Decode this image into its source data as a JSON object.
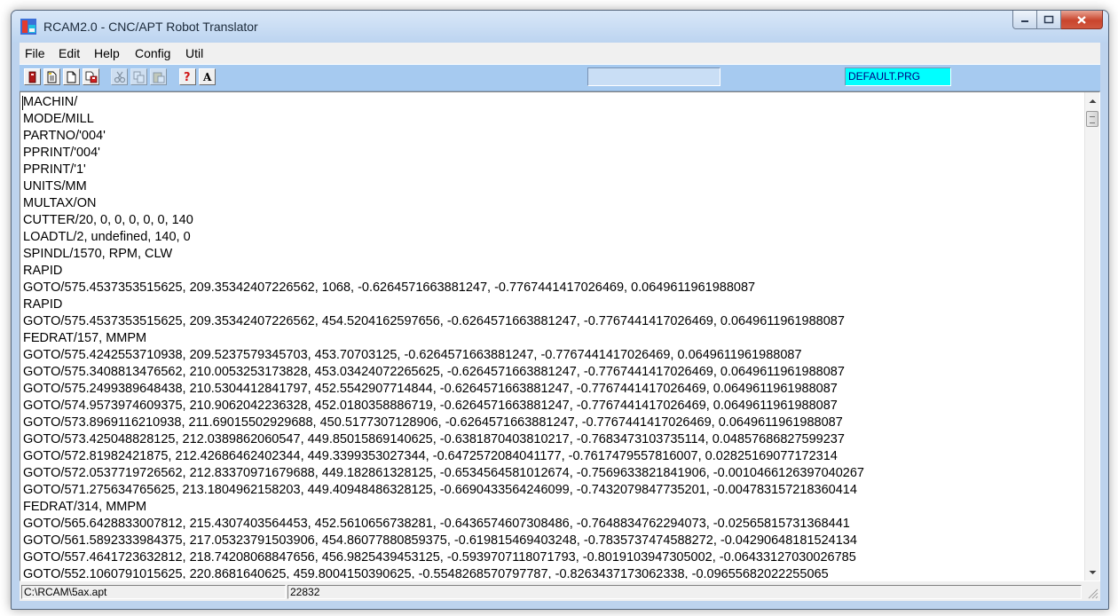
{
  "window": {
    "title": "RCAM2.0 - CNC/APT Robot Translator"
  },
  "menu": [
    "File",
    "Edit",
    "Help",
    "Config",
    "Util"
  ],
  "toolbar": {
    "program_field": "DEFAULT.PRG",
    "buttons": [
      "exit-icon",
      "open-file-icon",
      "new-file-icon",
      "save-file-icon",
      "cut-icon",
      "copy-icon",
      "paste-icon",
      "help-icon",
      "font-icon"
    ]
  },
  "editor": {
    "lines": [
      "MACHIN/",
      "MODE/MILL",
      "PARTNO/'004'",
      "PPRINT/'004'",
      "PPRINT/'1'",
      "UNITS/MM",
      "MULTAX/ON",
      "CUTTER/20, 0, 0, 0, 0, 0, 140",
      "LOADTL/2, undefined, 140, 0",
      "SPINDL/1570, RPM, CLW",
      "RAPID",
      "GOTO/575.4537353515625, 209.35342407226562, 1068, -0.6264571663881247, -0.7767441417026469, 0.0649611961988087",
      "RAPID",
      "GOTO/575.4537353515625, 209.35342407226562, 454.5204162597656, -0.6264571663881247, -0.7767441417026469, 0.0649611961988087",
      "FEDRAT/157, MMPM",
      "GOTO/575.4242553710938, 209.5237579345703, 453.70703125, -0.6264571663881247, -0.7767441417026469, 0.0649611961988087",
      "GOTO/575.3408813476562, 210.0053253173828, 453.03424072265625, -0.6264571663881247, -0.7767441417026469, 0.0649611961988087",
      "GOTO/575.2499389648438, 210.5304412841797, 452.5542907714844, -0.6264571663881247, -0.7767441417026469, 0.0649611961988087",
      "GOTO/574.9573974609375, 210.9062042236328, 452.0180358886719, -0.6264571663881247, -0.7767441417026469, 0.0649611961988087",
      "GOTO/573.8969116210938, 211.69015502929688, 450.5177307128906, -0.6264571663881247, -0.7767441417026469, 0.0649611961988087",
      "GOTO/573.425048828125, 212.0389862060547, 449.85015869140625, -0.6381870403810217, -0.7683473103735114, 0.04857686827599237",
      "GOTO/572.81982421875, 212.42686462402344, 449.3399353027344, -0.6472572084041177, -0.7617479557816007, 0.02825169077172314",
      "GOTO/572.0537719726562, 212.83370971679688, 449.182861328125, -0.6534564581012674, -0.7569633821841906, -0.0010466126397040267",
      "GOTO/571.275634765625, 213.1804962158203, 449.40948486328125, -0.6690433564246099, -0.7432079847735201, -0.004783157218360414",
      "FEDRAT/314, MMPM",
      "GOTO/565.6428833007812, 215.4307403564453, 452.5610656738281, -0.6436574607308486, -0.7648834762294073, -0.02565815731368441",
      "GOTO/561.5892333984375, 217.05323791503906, 454.86077880859375, -0.619815469403248, -0.7835737474588272, -0.04290648181524134",
      "GOTO/557.4641723632812, 218.74208068847656, 456.9825439453125, -0.5939707118071793, -0.8019103947305002, -0.06433127030026785",
      "GOTO/552.1060791015625, 220.8681640625, 459.8004150390625, -0.5548268570797787, -0.8263437173062338, -0.09655682022255065"
    ]
  },
  "status": {
    "file_path": "C:\\RCAM\\5ax.apt",
    "count": "22832"
  }
}
